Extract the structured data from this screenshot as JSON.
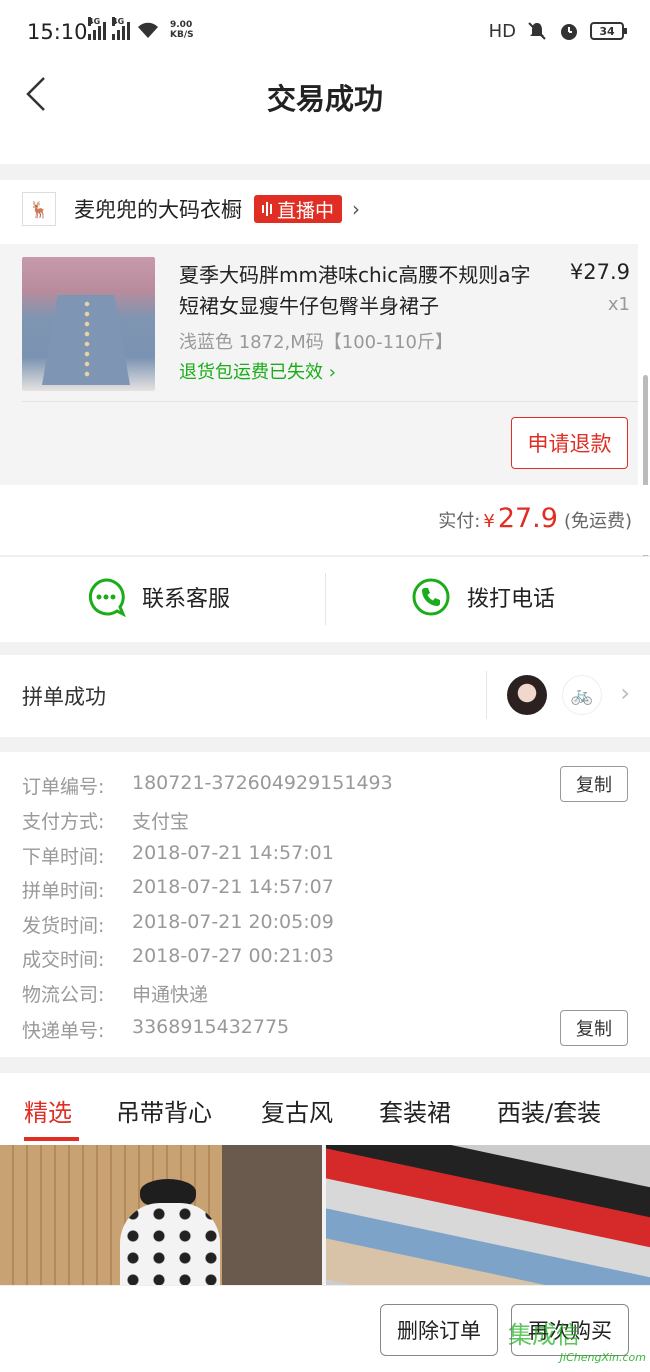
{
  "status_bar": {
    "time": "15:10",
    "signal1_label": "4G",
    "signal2_label": "4G",
    "net_speed_value": "9.00",
    "net_speed_unit": "KB/S",
    "hd_label": "HD",
    "battery": "34"
  },
  "nav": {
    "title": "交易成功"
  },
  "shop": {
    "logo_text": "🦌",
    "name": "麦兜兜的大码衣橱",
    "live_label": "直播中"
  },
  "product": {
    "title": "夏季大码胖mm港味chic高腰不规则a字短裙女显瘦牛仔包臀半身裙子",
    "price": "¥27.9",
    "quantity": "x1",
    "spec": "浅蓝色 1872,M码【100-110斤】",
    "return_note": "退货包运费已失效",
    "refund_button": "申请退款"
  },
  "payment": {
    "label": "实付:",
    "currency": "¥",
    "amount": "27.9",
    "note": "(免运费)"
  },
  "contact": {
    "service_label": "联系客服",
    "call_label": "拨打电话"
  },
  "group": {
    "label": "拼单成功"
  },
  "order_info": {
    "rows": [
      {
        "label": "订单编号:",
        "value": "180721-372604929151493"
      },
      {
        "label": "支付方式:",
        "value": "支付宝"
      },
      {
        "label": "下单时间:",
        "value": "2018-07-21 14:57:01"
      },
      {
        "label": "拼单时间:",
        "value": "2018-07-21 14:57:07"
      },
      {
        "label": "发货时间:",
        "value": "2018-07-21 20:05:09"
      },
      {
        "label": "成交时间:",
        "value": "2018-07-27 00:21:03"
      },
      {
        "label": "物流公司:",
        "value": "申通快递"
      },
      {
        "label": "快递单号:",
        "value": "3368915432775"
      }
    ],
    "copy_label": "复制"
  },
  "tabs": [
    {
      "label": "精选"
    },
    {
      "label": "吊带背心"
    },
    {
      "label": "复古风"
    },
    {
      "label": "套装裙"
    },
    {
      "label": "西装/套装"
    }
  ],
  "bottom": {
    "delete_label": "删除订单",
    "rebuy_label": "再次购买"
  },
  "watermark": {
    "text": "JiChengXin.com",
    "brand": "集成信"
  },
  "colors": {
    "accent": "#e02e24",
    "green": "#1aad19"
  }
}
